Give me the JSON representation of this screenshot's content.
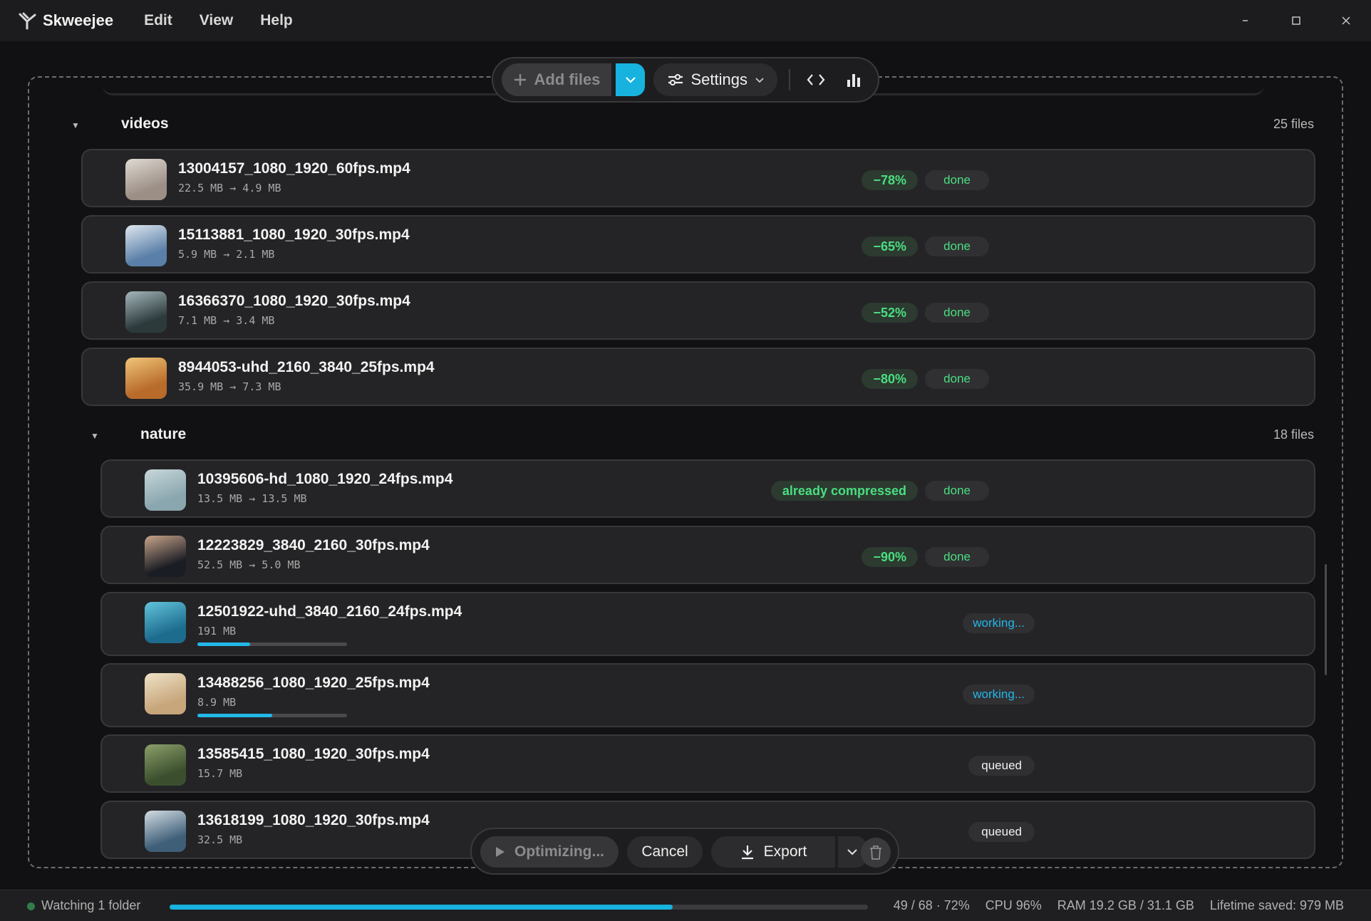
{
  "app": {
    "name": "Skweejee"
  },
  "menu": [
    "Edit",
    "View",
    "Help"
  ],
  "window_controls": [
    "minimize",
    "maximize",
    "close"
  ],
  "toolbar": {
    "add_files": "Add files",
    "settings": "Settings",
    "code_icon": "code-icon",
    "stats_icon": "bar-chart-icon"
  },
  "groups": [
    {
      "name": "videos",
      "count": "25 files",
      "files": [
        {
          "name": "13004157_1080_1920_60fps.mp4",
          "size": "22.5 MB → 4.9 MB",
          "pct": "−78%",
          "status": "done",
          "thumb": [
            "#9c8f86",
            "#e0dad3"
          ]
        },
        {
          "name": "15113881_1080_1920_30fps.mp4",
          "size": "5.9 MB → 2.1 MB",
          "pct": "−65%",
          "status": "done",
          "thumb": [
            "#5a7fa8",
            "#dfe7ef"
          ]
        },
        {
          "name": "16366370_1080_1920_30fps.mp4",
          "size": "7.1 MB → 3.4 MB",
          "pct": "−52%",
          "status": "done",
          "thumb": [
            "#2c3a3c",
            "#a5b8bc"
          ]
        },
        {
          "name": "8944053-uhd_2160_3840_25fps.mp4",
          "size": "35.9 MB → 7.3 MB",
          "pct": "−80%",
          "status": "done",
          "thumb": [
            "#b86b2a",
            "#f0c679"
          ]
        }
      ]
    },
    {
      "name": "nature",
      "count": "18 files",
      "files": [
        {
          "name": "10395606-hd_1080_1920_24fps.mp4",
          "size": "13.5 MB → 13.5 MB",
          "pct": "already compressed",
          "status": "done",
          "thumb": [
            "#8aa6ae",
            "#c7d7da"
          ]
        },
        {
          "name": "12223829_3840_2160_30fps.mp4",
          "size": "52.5 MB → 5.0 MB",
          "pct": "−90%",
          "status": "done",
          "thumb": [
            "#1a1d24",
            "#c8a48a"
          ]
        },
        {
          "name": "12501922-uhd_3840_2160_24fps.mp4",
          "size": "191 MB",
          "status": "working...",
          "progress": 0.35,
          "thumb": [
            "#1d6c8e",
            "#62c4dc"
          ]
        },
        {
          "name": "13488256_1080_1920_25fps.mp4",
          "size": "8.9 MB",
          "status": "working...",
          "progress": 0.5,
          "thumb": [
            "#c7a67b",
            "#efe2c8"
          ]
        },
        {
          "name": "13585415_1080_1920_30fps.mp4",
          "size": "15.7 MB",
          "status": "queued",
          "thumb": [
            "#3b4f2e",
            "#8c9f6a"
          ]
        },
        {
          "name": "13618199_1080_1920_30fps.mp4",
          "size": "32.5 MB",
          "status": "queued",
          "thumb": [
            "#3f5f78",
            "#d3dde4"
          ]
        }
      ]
    }
  ],
  "actions": {
    "optimizing": "Optimizing...",
    "cancel": "Cancel",
    "export": "Export"
  },
  "statusbar": {
    "watching": "Watching 1 folder",
    "overall_progress": 0.72,
    "progress_text": "49 / 68 · 72%",
    "cpu": "CPU 96%",
    "ram": "RAM 19.2 GB / 31.1 GB",
    "lifetime": "Lifetime saved: 979 MB"
  },
  "colors": {
    "accent": "#17b3de",
    "success": "#4ade80",
    "working": "#22b8e8"
  }
}
